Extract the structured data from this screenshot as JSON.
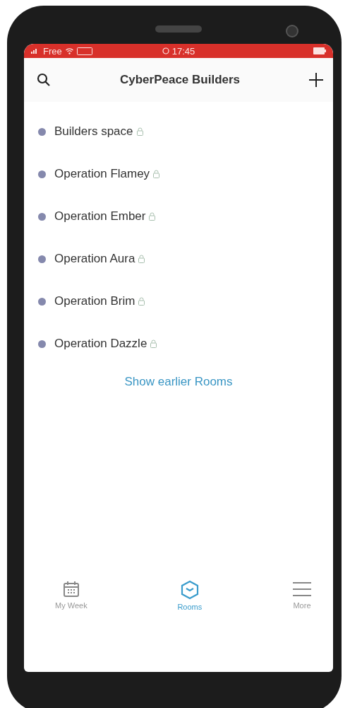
{
  "status_bar": {
    "carrier": "Free",
    "time": "17:45"
  },
  "header": {
    "title": "CyberPeace Builders"
  },
  "rooms": [
    {
      "name": "Builders space"
    },
    {
      "name": "Operation Flamey"
    },
    {
      "name": "Operation Ember"
    },
    {
      "name": "Operation Aura"
    },
    {
      "name": "Operation Brim"
    },
    {
      "name": "Operation Dazzle"
    }
  ],
  "show_earlier": "Show earlier Rooms",
  "tabs": [
    {
      "label": "My Week",
      "kind": "calendar",
      "selected": false
    },
    {
      "label": "Rooms",
      "kind": "rooms",
      "selected": true
    },
    {
      "label": "More",
      "kind": "menu",
      "selected": false
    }
  ]
}
